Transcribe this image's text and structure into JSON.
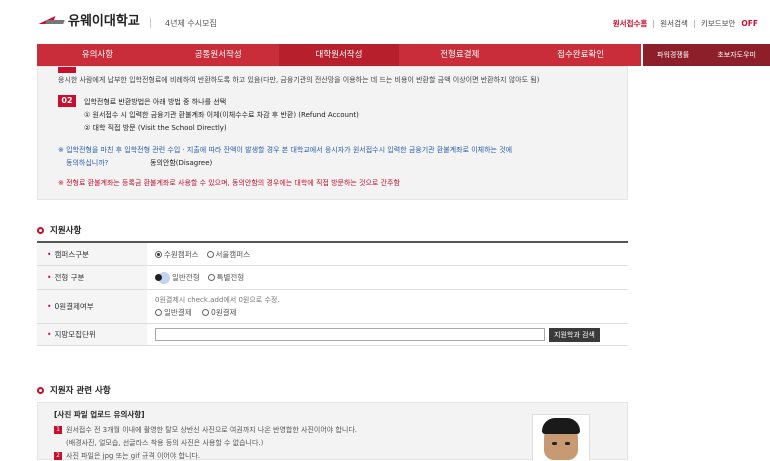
{
  "header": {
    "logo_text": "유웨이대학교",
    "subtitle": "4년제 수시모집",
    "nav": [
      "원서접수홈",
      "원서검색",
      "키보드보안"
    ],
    "nav_off": "OFF"
  },
  "menu": {
    "items": [
      "유의사항",
      "공통원서작성",
      "대학원서작성",
      "전형료결제",
      "접수완료확인"
    ],
    "side": [
      "파워경쟁률",
      "초보자도우미"
    ]
  },
  "notice": {
    "line0": "응시한 사람에게 납부한 입학전형료에 비례하여 반환하도록 하고 있음(다만, 금융기관의 전산망을 이용하는 데 드는 비용이 반환할 금액 이상이면 반환하지 않아도 됨)",
    "num02": "02",
    "line1": "입학전형료 반환방법은 아래 방법 중 하나를 선택",
    "line2": "① 원서접수 시 입력한 금융기관 환불계좌 이체(이체수수료 차감 후 반환) (Refund Account)",
    "line3": "② 대학 직접 방문 (Visit the School Directly)",
    "line4": "※ 입학전형을 마친 후 입학전형 관련 수입 · 지출에 따라 잔액이 발생할 경우 본 대학교에서 응시자가 원서접수시 입력한 금융기관 환불계좌로 이체하는 것에",
    "line5a": "동의하십니까?",
    "line5b": "동의안함(Disagree)",
    "line6": "※ 전형료 환불계좌는 등록금 환불계좌로 사용할 수 있으며, 동의안함의 경우에는 대학에 직접 방문하는 것으로 간주함"
  },
  "apply_section": {
    "title": "지원사항",
    "rows": [
      {
        "label": "캠퍼스구분",
        "options": [
          "수원캠퍼스",
          "서울캠퍼스"
        ]
      },
      {
        "label": "전형 구분",
        "options": [
          "일반전형",
          "특별전형"
        ]
      },
      {
        "label": "0원결제여부",
        "note": "0원결제시 check.add에서 0원으로 수정.",
        "options": [
          "일반결제",
          "0원결제"
        ]
      },
      {
        "label": "지망모집단위",
        "button": "지원학과 검색"
      }
    ]
  },
  "applicant_section": {
    "title": "지원자 관련 사항",
    "box_title": "[사진 파일 업로드 유의사항]",
    "lines": [
      "원서접수 전 3개월 이내에 촬영한 탈모 상반신 사진으로 여권까지 나온 반영합한 사진이어야 합니다.",
      "(배경사진, 얼모습, 선글라스 착용 등의 사진은 사용할 수 없습니다.)",
      "사진 파일은 jpg 또는 gif 규격 이어야 합니다."
    ],
    "nums": [
      "1",
      "2"
    ]
  }
}
